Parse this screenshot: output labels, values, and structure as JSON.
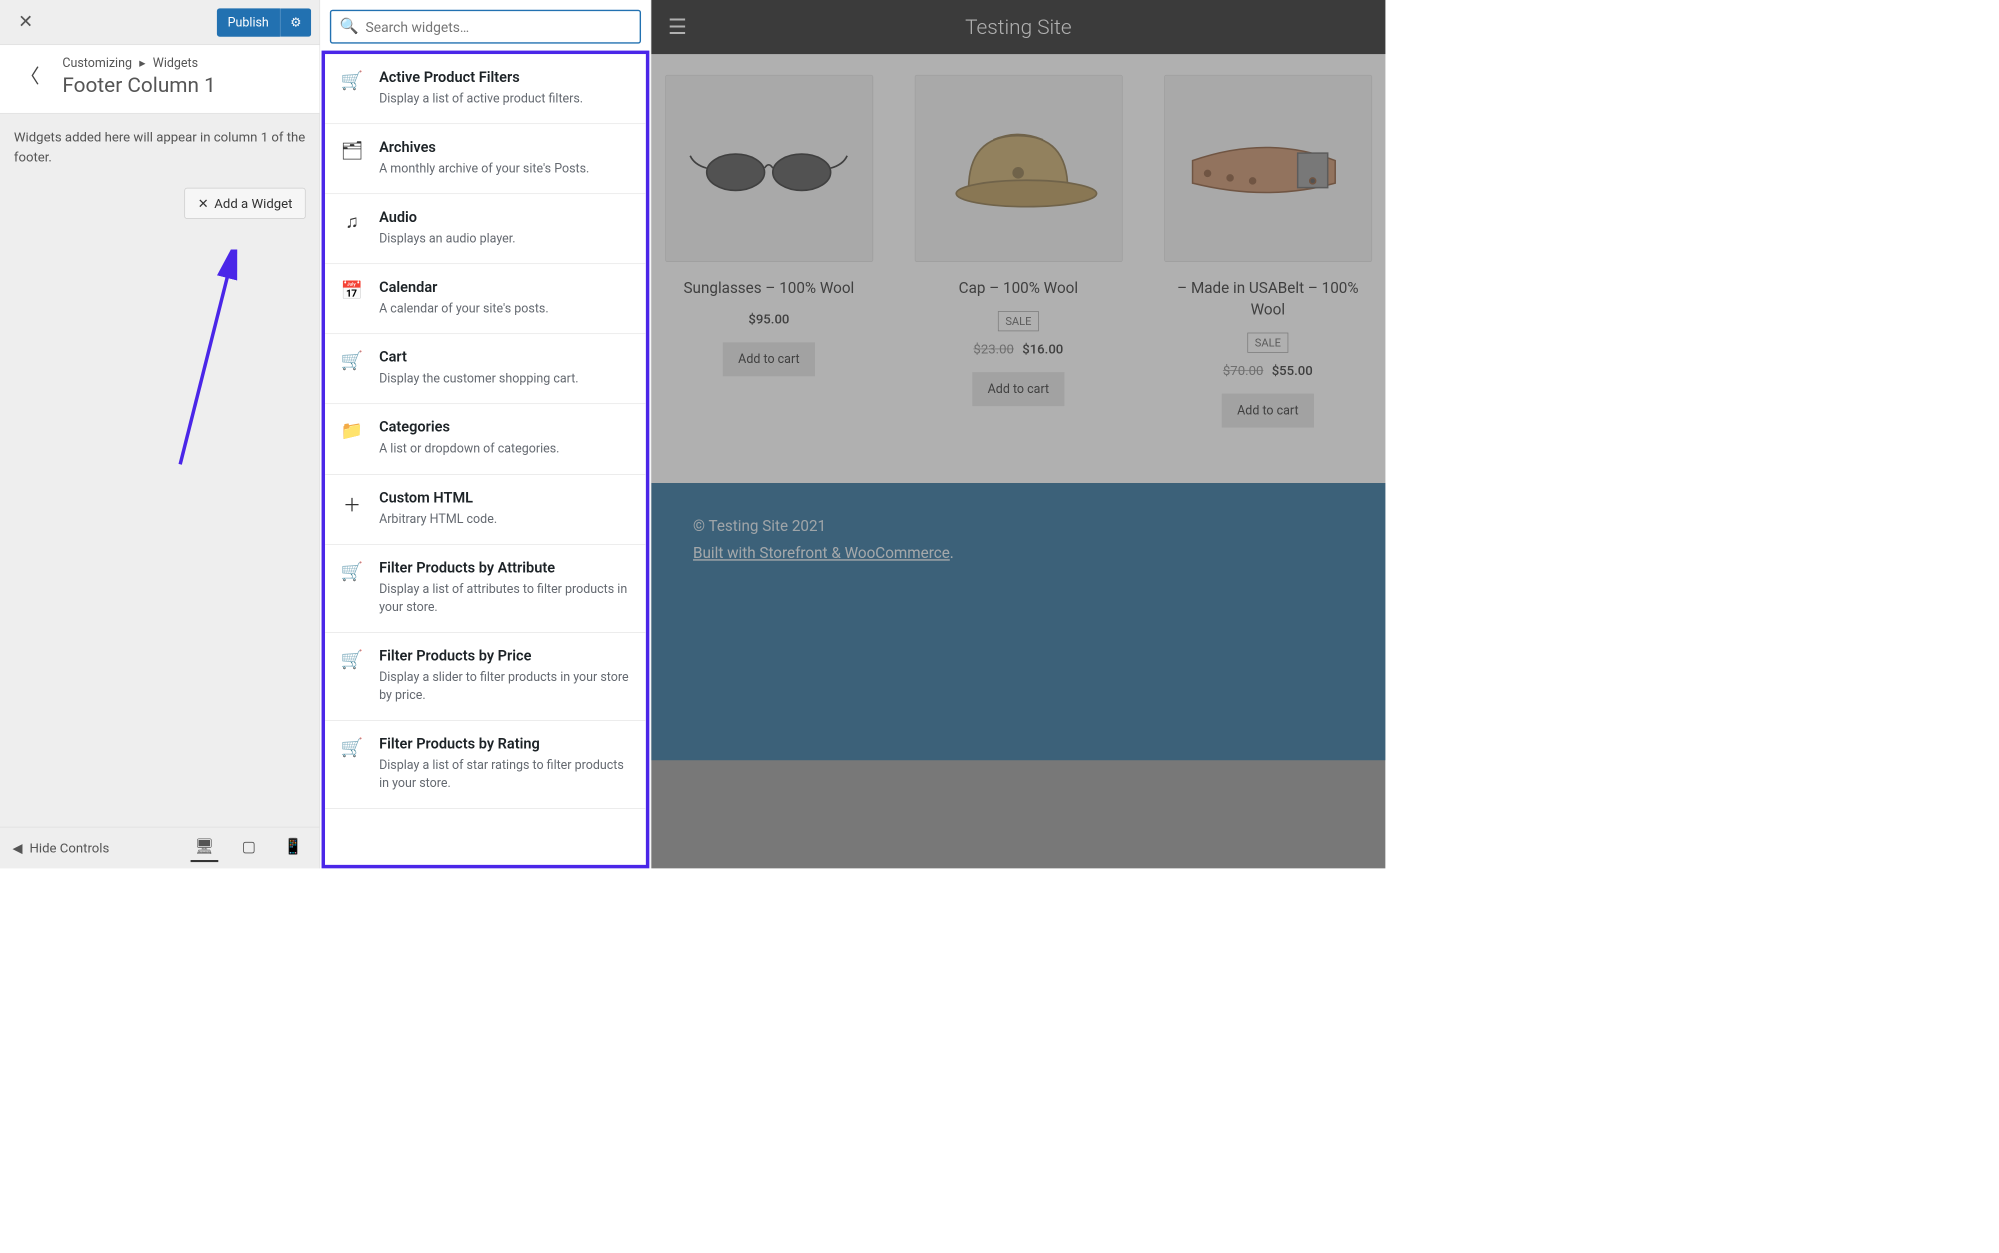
{
  "topbar": {
    "publish_label": "Publish"
  },
  "breadcrumb": {
    "parent": "Customizing",
    "child": "Widgets"
  },
  "section": {
    "title": "Footer Column 1",
    "description": "Widgets added here will appear in column 1 of the footer.",
    "add_widget_label": "Add a Widget"
  },
  "footer_controls": {
    "hide_label": "Hide Controls"
  },
  "search": {
    "placeholder": "Search widgets…"
  },
  "widgets": [
    {
      "icon": "🛒",
      "title": "Active Product Filters",
      "desc": "Display a list of active product filters."
    },
    {
      "icon": "🗂",
      "title": "Archives",
      "desc": "A monthly archive of your site's Posts."
    },
    {
      "icon": "♫",
      "title": "Audio",
      "desc": "Displays an audio player."
    },
    {
      "icon": "📅",
      "title": "Calendar",
      "desc": "A calendar of your site's posts."
    },
    {
      "icon": "🛒",
      "title": "Cart",
      "desc": "Display the customer shopping cart."
    },
    {
      "icon": "📁",
      "title": "Categories",
      "desc": "A list or dropdown of categories."
    },
    {
      "icon": "＋",
      "title": "Custom HTML",
      "desc": "Arbitrary HTML code."
    },
    {
      "icon": "🛒",
      "title": "Filter Products by Attribute",
      "desc": "Display a list of attributes to filter products in your store."
    },
    {
      "icon": "🛒",
      "title": "Filter Products by Price",
      "desc": "Display a slider to filter products in your store by price."
    },
    {
      "icon": "🛒",
      "title": "Filter Products by Rating",
      "desc": "Display a list of star ratings to filter products in your store."
    }
  ],
  "site": {
    "title": "Testing Site",
    "footer_copy": "© Testing Site 2021",
    "footer_link": "Built with Storefront & WooCommerce",
    "footer_link_suffix": "."
  },
  "products": [
    {
      "title": "Sunglasses – 100% Wool",
      "price": "$95.00",
      "sale": false,
      "old": "",
      "btn": "Add to cart"
    },
    {
      "title": "Cap – 100% Wool",
      "price": "$16.00",
      "old": "$23.00",
      "sale": true,
      "btn": "Add to cart"
    },
    {
      "title": "– Made in USABelt – 100% Wool",
      "price": "$55.00",
      "old": "$70.00",
      "sale": true,
      "btn": "Add to cart"
    }
  ],
  "sale_label": "SALE"
}
